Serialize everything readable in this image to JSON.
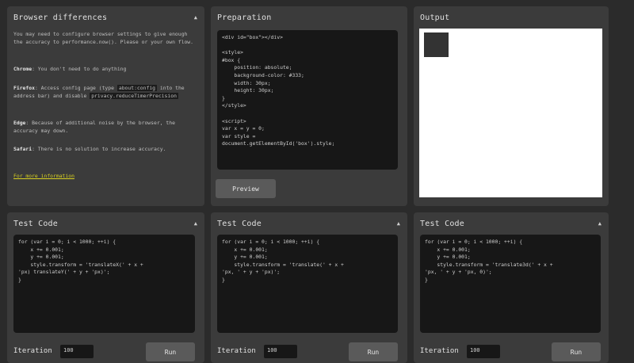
{
  "browser_panel": {
    "title": "Browser differences",
    "intro": "You may need to configure browser settings to give enough the accuracy to performance.now(). Please or your own flow.",
    "chrome_label": "Chrome",
    "chrome_text": ": You don't need to do anything",
    "firefox_label": "Firefox",
    "firefox_text": ": Access config page (type",
    "firefox_code1": "about:config",
    "firefox_text2": "into the address bar) and disable",
    "firefox_code2": "privacy.reduceTimerPrecision",
    "edge_label": "Edge",
    "edge_text": ": Because of additional noise by the browser, the accuracy may down.",
    "safari_label": "Safari",
    "safari_text": ": There is no solution to increase accuracy.",
    "more_info_link": "For more information"
  },
  "preparation": {
    "title": "Preparation",
    "code": "<div id=\"box\"></div>\n\n<style>\n#box {\n    position: absolute;\n    background-color: #333;\n    width: 30px;\n    height: 30px;\n}\n</style>\n\n<script>\nvar x = y = 0;\nvar style =\ndocument.getElementById('box').style;",
    "button": "Preview"
  },
  "output": {
    "title": "Output"
  },
  "tests": [
    {
      "title": "Test Code",
      "code": "for (var i = 0; i < 1000; ++i) {\n    x += 0.001;\n    y += 0.001;\n    style.transform = 'translateX(' + x +\n'px) translateY(' + y + 'px)';\n}",
      "iteration_label": "Iteration",
      "iteration_value": "100",
      "run": "Run"
    },
    {
      "title": "Test Code",
      "code": "for (var i = 0; i < 1000; ++i) {\n    x += 0.001;\n    y += 0.001;\n    style.transform = 'translate(' + x +\n'px, ' + y + 'px)';\n}",
      "iteration_label": "Iteration",
      "iteration_value": "100",
      "run": "Run"
    },
    {
      "title": "Test Code",
      "code": "for (var i = 0; i < 1000; ++i) {\n    x += 0.001;\n    y += 0.001;\n    style.transform = 'translate3d(' + x +\n'px, ' + y + 'px, 0)';\n}",
      "iteration_label": "Iteration",
      "iteration_value": "100",
      "run": "Run"
    }
  ]
}
